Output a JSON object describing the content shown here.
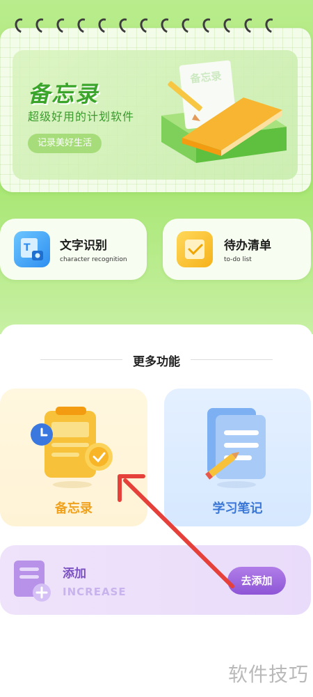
{
  "hero": {
    "title": "备忘录",
    "subtitle": "超级好用的计划软件",
    "button": "记录美好生活",
    "paper_label": "备忘录"
  },
  "tools": [
    {
      "title": "文字识别",
      "subtitle": "character recognition",
      "icon": "text-recognition-icon"
    },
    {
      "title": "待办清单",
      "subtitle": "to-do list",
      "icon": "todo-list-icon"
    }
  ],
  "more": {
    "title": "更多功能",
    "features": [
      {
        "label": "备忘录",
        "icon": "memo-clipboard-icon"
      },
      {
        "label": "学习笔记",
        "icon": "study-notes-icon"
      }
    ]
  },
  "add": {
    "title": "添加",
    "subtitle": "INCREASE",
    "button": "去添加"
  },
  "watermark": "软件技巧",
  "colors": {
    "green": "#3aa52a",
    "purple": "#8e55d6",
    "arrow": "#e5403a"
  }
}
